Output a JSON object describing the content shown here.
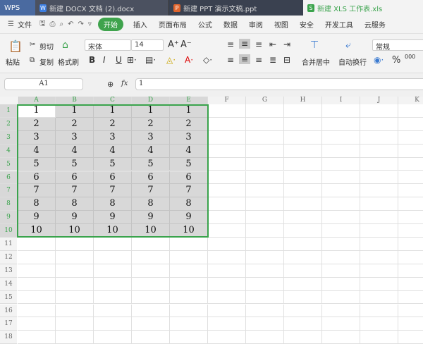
{
  "tabs": [
    {
      "label": "WPS"
    },
    {
      "label": "新建 DOCX 文档 (2).docx",
      "icon": "W"
    },
    {
      "label": "新建 PPT 演示文稿.ppt",
      "icon": "P"
    },
    {
      "label": "新建 XLS 工作表.xls",
      "icon": "S"
    }
  ],
  "menu": {
    "file": "文件",
    "items": [
      "开始",
      "插入",
      "页面布局",
      "公式",
      "数据",
      "审阅",
      "视图",
      "安全",
      "开发工具",
      "云服务"
    ]
  },
  "toolbar": {
    "paste": "粘贴",
    "cut": "剪切",
    "copy": "复制",
    "format_painter": "格式刷",
    "font": "宋体",
    "font_size": "14",
    "merge": "合并居中",
    "wrap": "自动换行",
    "number_format": "常规",
    "bold": "B",
    "italic": "I",
    "underline": "U",
    "percent": "%"
  },
  "formula": {
    "name_box": "A1",
    "fx": "fx",
    "value": "1"
  },
  "columns": [
    "A",
    "B",
    "C",
    "D",
    "E",
    "F",
    "G",
    "H",
    "I",
    "J",
    "K"
  ],
  "rows": [
    "1",
    "2",
    "3",
    "4",
    "5",
    "6",
    "7",
    "8",
    "9",
    "10",
    "11",
    "12",
    "13",
    "14",
    "15",
    "16",
    "17",
    "18"
  ],
  "cells": [
    [
      "1",
      "1",
      "1",
      "1",
      "1"
    ],
    [
      "2",
      "2",
      "2",
      "2",
      "2"
    ],
    [
      "3",
      "3",
      "3",
      "3",
      "3"
    ],
    [
      "4",
      "4",
      "4",
      "4",
      "4"
    ],
    [
      "5",
      "5",
      "5",
      "5",
      "5"
    ],
    [
      "6",
      "6",
      "6",
      "6",
      "6"
    ],
    [
      "7",
      "7",
      "7",
      "7",
      "7"
    ],
    [
      "8",
      "8",
      "8",
      "8",
      "8"
    ],
    [
      "9",
      "9",
      "9",
      "9",
      "9"
    ],
    [
      "10",
      "10",
      "10",
      "10",
      "10"
    ]
  ],
  "colors": {
    "accent": "#3aa34c"
  }
}
